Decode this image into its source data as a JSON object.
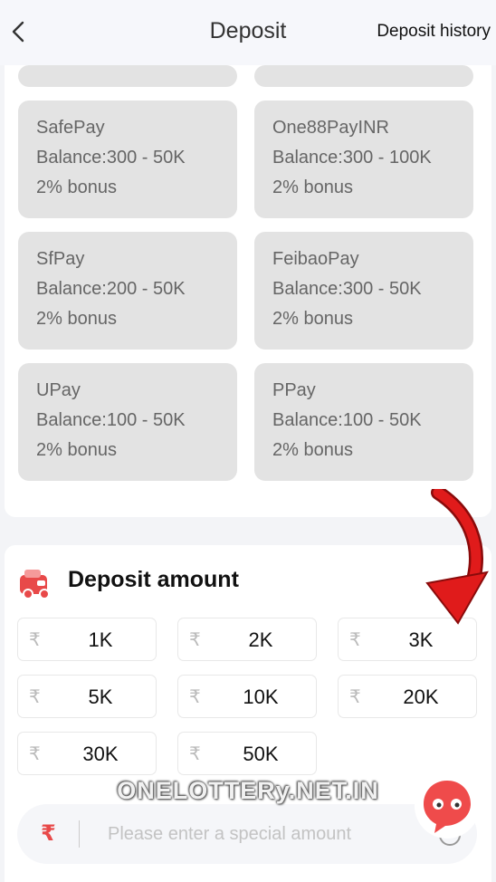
{
  "header": {
    "title": "Deposit",
    "history_label": "Deposit history"
  },
  "channels": [
    {
      "name": "SafePay",
      "balance": "Balance:300 - 50K",
      "bonus": "2% bonus"
    },
    {
      "name": "One88PayINR",
      "balance": "Balance:300 - 100K",
      "bonus": "2% bonus"
    },
    {
      "name": "SfPay",
      "balance": "Balance:200 - 50K",
      "bonus": "2% bonus"
    },
    {
      "name": "FeibaoPay",
      "balance": "Balance:300 - 50K",
      "bonus": "2% bonus"
    },
    {
      "name": "UPay",
      "balance": "Balance:100 - 50K",
      "bonus": "2% bonus"
    },
    {
      "name": "PPay",
      "balance": "Balance:100 - 50K",
      "bonus": "2% bonus"
    }
  ],
  "deposit_amount": {
    "title": "Deposit amount",
    "currency_symbol": "₹",
    "options": [
      "1K",
      "2K",
      "3K",
      "5K",
      "10K",
      "20K",
      "30K",
      "50K"
    ],
    "special_placeholder": "Please enter a special amount"
  },
  "watermark": "ONELOTTERy.NET.IN",
  "colors": {
    "accent_red": "#e84949",
    "card_bg": "#e3e3e3",
    "arrow_red": "#e01b1b"
  },
  "icons": {
    "back": "chevron-left-icon",
    "wallet": "wallet-icon",
    "clear": "clear-icon",
    "chat": "chat-icon",
    "arrow": "arrow-pointer-icon"
  }
}
